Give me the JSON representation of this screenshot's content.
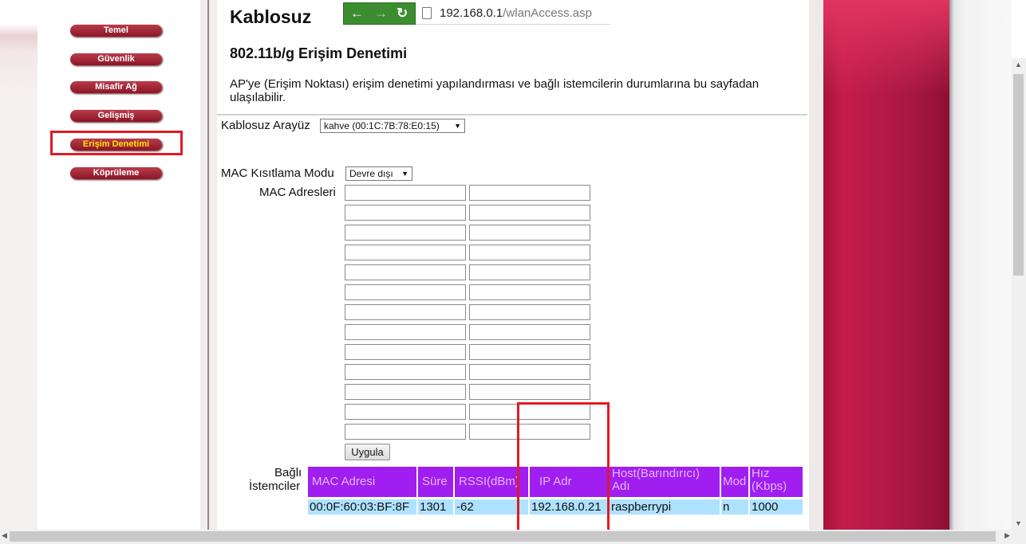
{
  "nav": {
    "items": [
      {
        "label": "Temel"
      },
      {
        "label": "Güvenlik"
      },
      {
        "label": "Misafir Ağ"
      },
      {
        "label": "Gelişmiş"
      },
      {
        "label": "Erişim Denetimi"
      },
      {
        "label": "Köprüleme"
      }
    ],
    "active": "Erişim Denetimi"
  },
  "page": {
    "title": "Kablosuz",
    "subtitle": "802.11b/g Erişim Denetimi",
    "description": "AP'ye (Erişim Noktası) erişim denetimi yapılandırması ve bağlı istemcilerin durumlarına bu sayfadan ulaşılabilir."
  },
  "browser": {
    "url_host": "192.168.0.1",
    "url_path": "/wlanAccess.asp"
  },
  "form": {
    "interface_label": "Kablosuz Arayüz",
    "interface_value": "kahve (00:1C:7B:78:E0:15)",
    "mac_mode_label": "MAC Kısıtlama Modu",
    "mac_mode_value": "Devre dışı",
    "mac_addresses_label": "MAC Adresleri",
    "apply_label": "Uygula"
  },
  "clients": {
    "label_line1": "Bağlı",
    "label_line2": "İstemciler",
    "headers": [
      "MAC Adresi",
      "Süre",
      "RSSI(dBm)",
      "IP Adr",
      "Host(Barındırıcı) Adı",
      "Mod",
      "Hız (Kbps)"
    ],
    "rows": [
      [
        "00:0F:60:03:BF:8F",
        "1301",
        "-62",
        "192.168.0.21",
        "raspberrypi",
        "n",
        "1000"
      ]
    ]
  },
  "colors": {
    "table_header_bg": "#a01ef0",
    "table_row_bg": "#aee2ff",
    "nav_button": "#a3263a",
    "highlight": "#e01b24"
  }
}
